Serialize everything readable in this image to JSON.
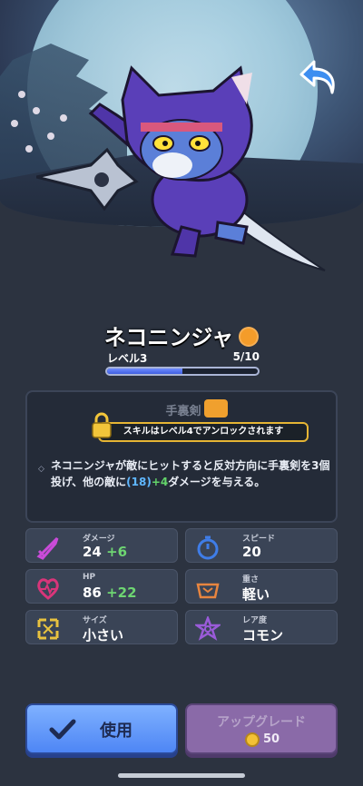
{
  "character": {
    "name": "ネコニンジャ",
    "level_label": "レベル3",
    "card_count": "5/10",
    "card_progress": 0.5
  },
  "skill": {
    "name": "手裏剣",
    "lock_text": "スキルはレベル4でアンロックされます",
    "desc_part1": "ネコニンジャが敵にヒットすると反対方向に手裏剣を3個投げ、他の敵に",
    "desc_value": "(18)",
    "desc_bonus": "+4",
    "desc_part2": "ダメージを与える。"
  },
  "stats": [
    {
      "label": "ダメージ",
      "value": "24",
      "bonus": "+6",
      "icon": "sword-icon",
      "color": "#c94bd9"
    },
    {
      "label": "スピード",
      "value": "20",
      "bonus": "",
      "icon": "stopwatch-icon",
      "color": "#3f7de8"
    },
    {
      "label": "HP",
      "value": "86",
      "bonus": "+22",
      "icon": "heart-icon",
      "color": "#d9357a"
    },
    {
      "label": "重さ",
      "value": "軽い",
      "bonus": "",
      "icon": "weight-icon",
      "color": "#e8853f"
    },
    {
      "label": "サイズ",
      "value": "小さい",
      "bonus": "",
      "icon": "size-arrows-icon",
      "color": "#e8c23f"
    },
    {
      "label": "レア度",
      "value": "コモン",
      "bonus": "",
      "icon": "rarity-star-icon",
      "color": "#9a5bd9"
    }
  ],
  "buttons": {
    "use_label": "使用",
    "upgrade_label": "アップグレード",
    "upgrade_cost": "50"
  }
}
